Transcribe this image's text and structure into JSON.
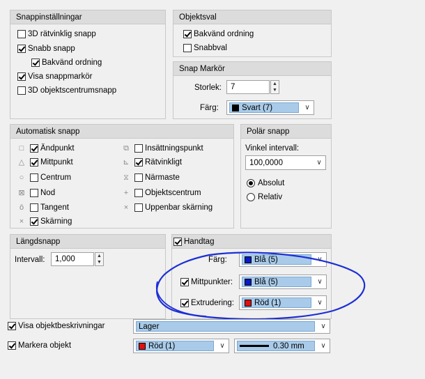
{
  "colors": {
    "blue": "#0a18c9",
    "red": "#e01010",
    "black": "#000000",
    "highlight": "#a9cbe9",
    "annotation": "#1d2fd6"
  },
  "snap_settings": {
    "title": "Snappinställningar",
    "items": [
      "3D rätvinklig snapp",
      "Snabb snapp",
      "Bakvänd ordning",
      "Visa snappmarkör",
      "3D objektscentrumsnapp"
    ],
    "checked": [
      false,
      true,
      true,
      true,
      false
    ]
  },
  "object_select": {
    "title": "Objektsval",
    "items": [
      "Bakvänd ordning",
      "Snabbval"
    ],
    "checked": [
      true,
      false
    ]
  },
  "snap_marker": {
    "title": "Snap Markör",
    "size_label": "Storlek:",
    "size_value": "7",
    "color_label": "Färg:",
    "color_value": "Svart (7)"
  },
  "auto_snap": {
    "title": "Automatisk snapp",
    "left_items": [
      "Ändpunkt",
      "Mittpunkt",
      "Centrum",
      "Nod",
      "Tangent",
      "Skärning"
    ],
    "left_checked": [
      true,
      true,
      false,
      false,
      false,
      true
    ],
    "left_icons": [
      "endpoint-icon",
      "midpoint-icon",
      "center-icon",
      "node-icon",
      "tangent-icon",
      "intersection-icon"
    ],
    "right_items": [
      "Insättningspunkt",
      "Rätvinkligt",
      "Närmaste",
      "Objektscentrum",
      "Uppenbar skärning"
    ],
    "right_checked": [
      false,
      true,
      false,
      false,
      false
    ],
    "right_icons": [
      "insertion-icon",
      "perpendicular-icon",
      "nearest-icon",
      "object-center-icon",
      "apparent-intersection-icon"
    ]
  },
  "polar_snap": {
    "title": "Polär snapp",
    "interval_label": "Vinkel intervall:",
    "interval_value": "100,0000",
    "options": [
      "Absolut",
      "Relativ"
    ],
    "selected": 0
  },
  "length_snap": {
    "title": "Längdsnapp",
    "interval_label": "Intervall:",
    "interval_value": "1,000"
  },
  "grips": {
    "title": "Handtag",
    "checked": true,
    "color_label": "Färg:",
    "color_value": "Blå (5)",
    "mid_label": "Mittpunkter:",
    "mid_checked": true,
    "mid_value": "Blå (5)",
    "extr_label": "Extrudering:",
    "extr_checked": true,
    "extr_value": "Röd (1)"
  },
  "bottom": {
    "show_desc_label": "Visa objektbeskrivningar",
    "show_desc_checked": true,
    "show_desc_value": "Lager",
    "highlight_label": "Markera objekt",
    "highlight_checked": true,
    "highlight_color": "Röd (1)",
    "lineweight": "0.30 mm"
  }
}
